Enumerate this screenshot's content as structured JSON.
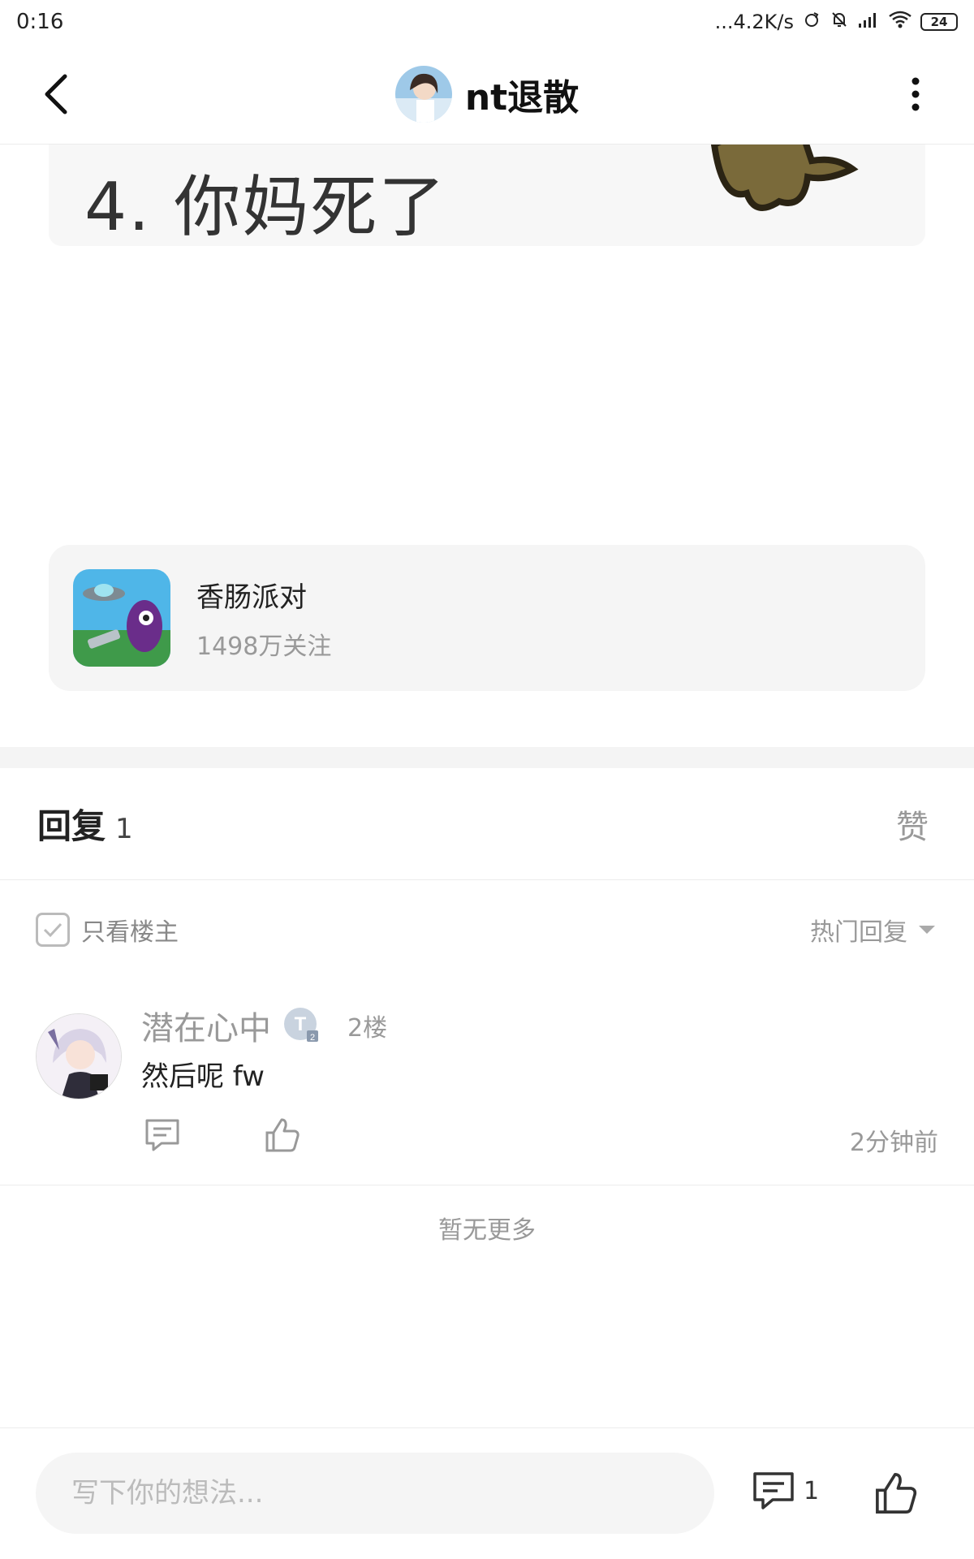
{
  "status_bar": {
    "time": "0:16",
    "net_speed": "...4.2K/s",
    "battery": "24"
  },
  "header": {
    "title": "nt退散"
  },
  "post": {
    "image_text": "4. 你妈死了"
  },
  "community": {
    "name": "香肠派对",
    "followers": "1498万关注"
  },
  "replies": {
    "title": "回复",
    "count": "1",
    "like_tab": "赞",
    "only_op_label": "只看楼主",
    "sort_label": "热门回复"
  },
  "comments": [
    {
      "user": "潜在心中",
      "floor": "2楼",
      "text": "然后呢 fw",
      "time": "2分钟前"
    }
  ],
  "no_more": "暂无更多",
  "bottom_bar": {
    "input_placeholder": "写下你的想法...",
    "comment_count": "1"
  }
}
